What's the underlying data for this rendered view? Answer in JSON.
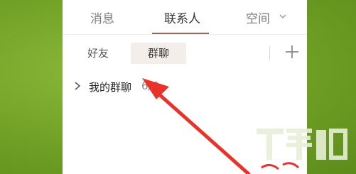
{
  "top_tabs": [
    {
      "label": "消息"
    },
    {
      "label": "联系人"
    },
    {
      "label": "空间"
    }
  ],
  "sub_tabs": [
    {
      "label": "好友"
    },
    {
      "label": "群聊"
    }
  ],
  "group_list": {
    "label": "我的群聊",
    "count": "6/6"
  },
  "colors": {
    "active_underline": "#8a6a5a",
    "active_subtab_bg": "#f3eee9",
    "arrow": "#e8332a",
    "background_green": "#6f9f24"
  },
  "icons": {
    "space_dropdown": "chevron-down-icon",
    "add": "plus-icon",
    "expand": "chevron-right-icon"
  }
}
